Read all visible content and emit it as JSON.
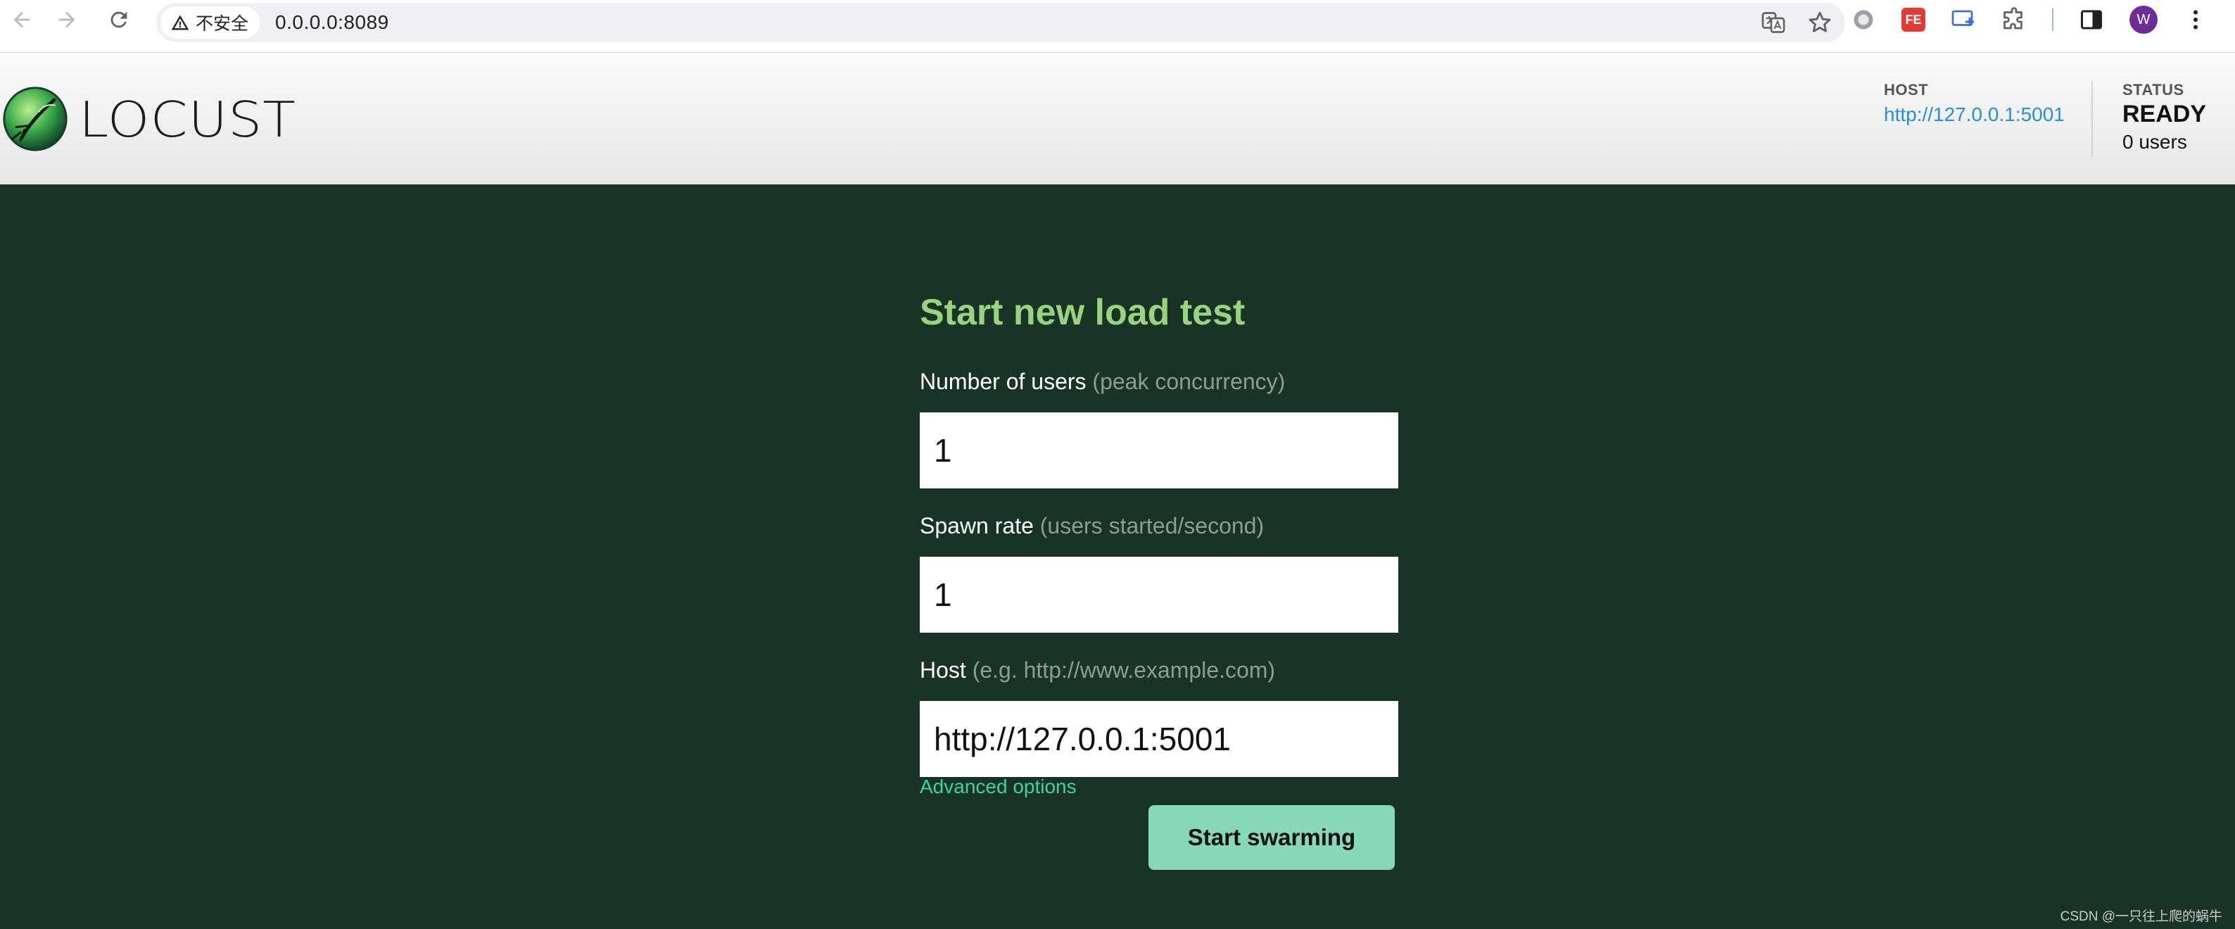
{
  "browser": {
    "security_label": "不安全",
    "url": "0.0.0.0:8089",
    "profile_initial": "W"
  },
  "header": {
    "logo_text": "LOCUST",
    "host_label": "HOST",
    "host_value": "http://127.0.0.1:5001",
    "status_label": "STATUS",
    "status_value": "READY",
    "users_value": "0 users"
  },
  "form": {
    "title": "Start new load test",
    "users_label": "Number of users",
    "users_hint": "(peak concurrency)",
    "users_value": "1",
    "spawn_label": "Spawn rate",
    "spawn_hint": "(users started/second)",
    "spawn_value": "1",
    "host_label": "Host",
    "host_hint": "(e.g. http://www.example.com)",
    "host_value": "http://127.0.0.1:5001",
    "advanced_label": "Advanced options",
    "submit_label": "Start swarming"
  },
  "watermark": "CSDN @一只往上爬的蜗牛",
  "icons": {
    "back": "back-arrow-icon",
    "forward": "forward-arrow-icon",
    "reload": "reload-icon",
    "warning": "warning-icon",
    "translate": "translate-icon",
    "bookmark": "star-icon",
    "extensions": "puzzle-icon",
    "side_panel": "side-panel-icon",
    "menu": "kebab-menu-icon"
  },
  "colors": {
    "page_bg": "#193326",
    "title": "#97d47e",
    "button": "#87d8b7",
    "link": "#3ed49d",
    "host_link": "#2a8ed0"
  }
}
